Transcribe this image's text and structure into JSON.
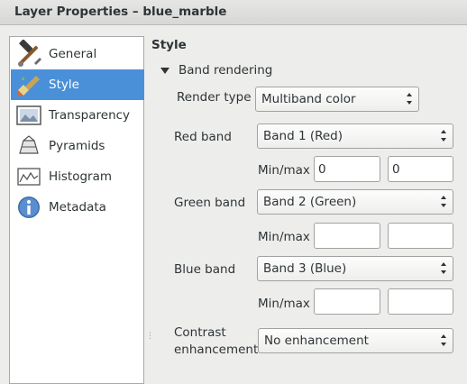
{
  "window": {
    "title": "Layer Properties – blue_marble"
  },
  "sidebar": {
    "items": [
      {
        "label": "General",
        "icon": "hammer-wrench-icon",
        "active": false
      },
      {
        "label": "Style",
        "icon": "paintbrush-icon",
        "active": true
      },
      {
        "label": "Transparency",
        "icon": "transparency-icon",
        "active": false
      },
      {
        "label": "Pyramids",
        "icon": "pyramid-icon",
        "active": false
      },
      {
        "label": "Histogram",
        "icon": "histogram-icon",
        "active": false
      },
      {
        "label": "Metadata",
        "icon": "info-icon",
        "active": false
      }
    ]
  },
  "main": {
    "heading": "Style",
    "section_title": "Band rendering",
    "render_type": {
      "label": "Render type",
      "value": "Multiband color"
    },
    "red_band": {
      "label": "Red band",
      "value": "Band 1 (Red)",
      "minmax_label": "Min/max",
      "min": "0",
      "max": "0"
    },
    "green_band": {
      "label": "Green band",
      "value": "Band 2 (Green)",
      "minmax_label": "Min/max",
      "min": "",
      "max": ""
    },
    "blue_band": {
      "label": "Blue band",
      "value": "Band 3 (Blue)",
      "minmax_label": "Min/max",
      "min": "",
      "max": ""
    },
    "contrast": {
      "label_line1": "Contrast",
      "label_line2": "enhancement",
      "value": "No enhancement"
    }
  },
  "colors": {
    "selection": "#4a90d9",
    "window_bg": "#ededec",
    "title_bg": "#dcdcdb"
  }
}
